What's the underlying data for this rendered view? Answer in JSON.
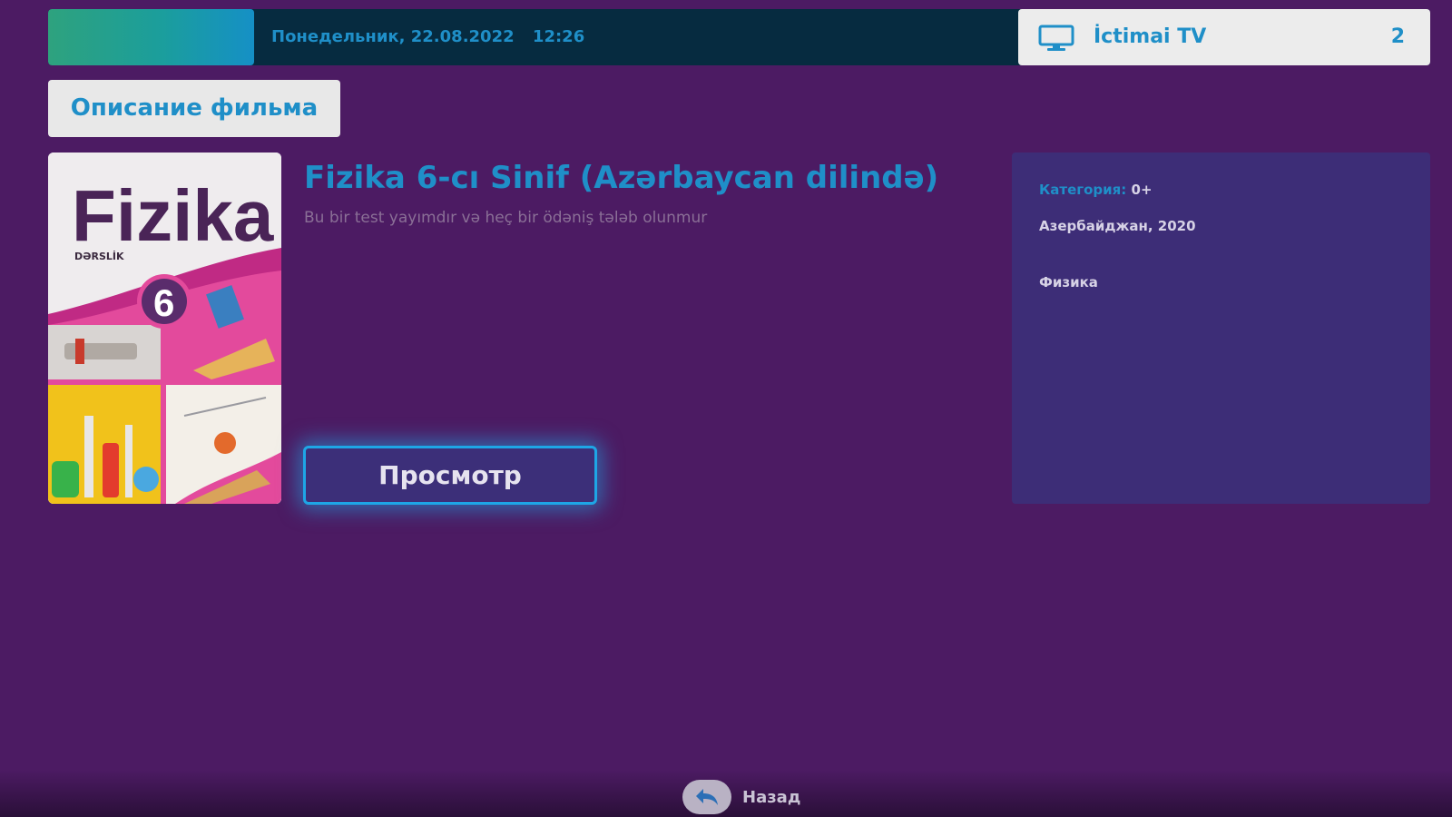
{
  "status_bar": {
    "date": "Понедельник, 22.08.2022",
    "time": "12:26"
  },
  "channel": {
    "icon": "tv-monitor-icon",
    "name": "İctimai TV",
    "number": "2"
  },
  "section_tab": {
    "label": "Описание фильма"
  },
  "poster": {
    "title": "Fizika",
    "subtitle": "DƏRSLİK",
    "grade": "6"
  },
  "movie": {
    "title": "Fizika 6-cı Sinif (Azərbaycan dilində)",
    "description": "Bu bir test yayımdır və heç bir ödəniş tələb olunmur"
  },
  "watch_button": {
    "label": "Просмотр"
  },
  "info": {
    "category_label": "Категория:",
    "category_value": "0+",
    "country_year": "Азербайджан, 2020",
    "genre": "Физика"
  },
  "footer": {
    "back_icon": "back-arrow-icon",
    "back_label": "Назад"
  },
  "colors": {
    "background": "#4c1b63",
    "accent": "#1f8fc8",
    "panel": "#3d2d77",
    "button_glow": "#1ea6e6"
  }
}
